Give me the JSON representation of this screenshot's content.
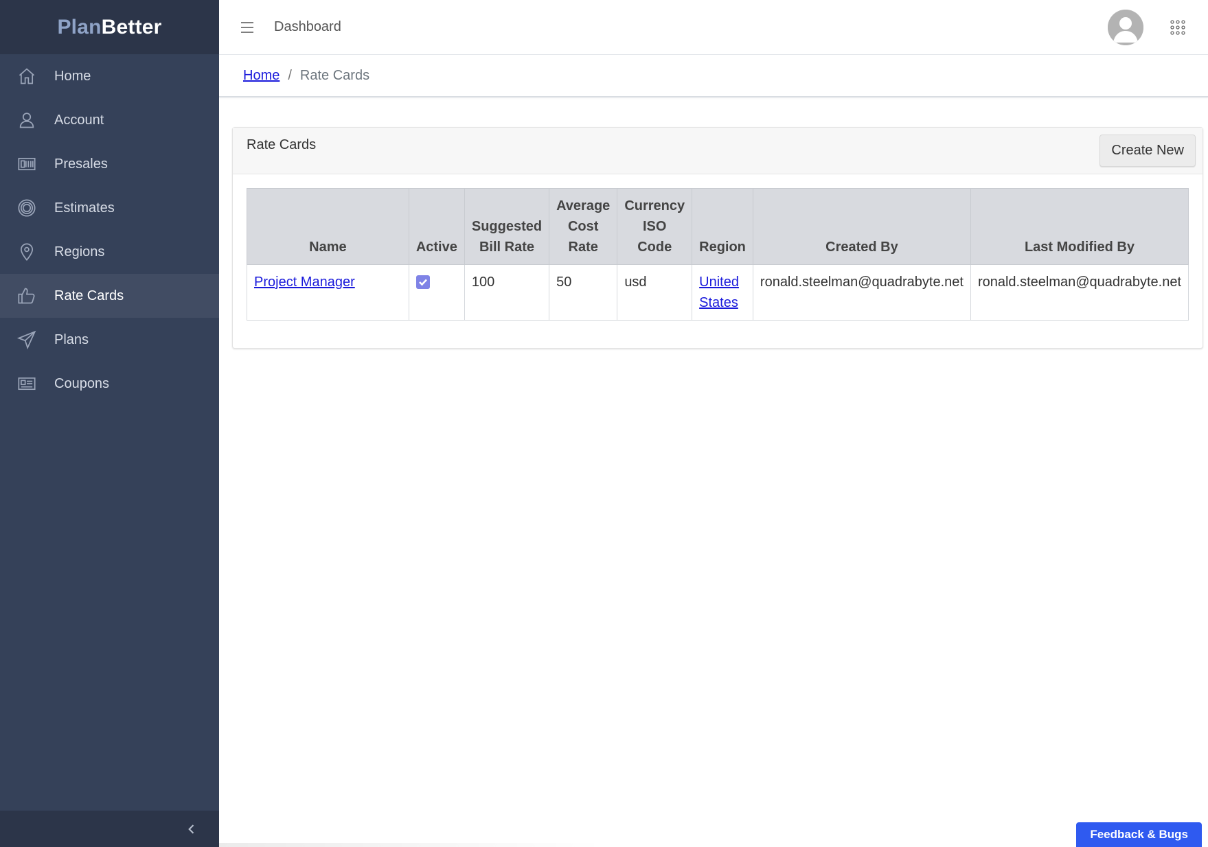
{
  "brand": {
    "part1": "Plan",
    "part2": "Better"
  },
  "sidebar": {
    "items": [
      {
        "label": "Home",
        "icon": "home-icon"
      },
      {
        "label": "Account",
        "icon": "user-icon"
      },
      {
        "label": "Presales",
        "icon": "presales-icon"
      },
      {
        "label": "Estimates",
        "icon": "target-icon"
      },
      {
        "label": "Regions",
        "icon": "map-pin-icon"
      },
      {
        "label": "Rate Cards",
        "icon": "thumbs-up-icon",
        "active": true
      },
      {
        "label": "Plans",
        "icon": "send-icon"
      },
      {
        "label": "Coupons",
        "icon": "coupon-icon"
      }
    ],
    "collapse_icon": "chevron-left-icon"
  },
  "topbar": {
    "title": "Dashboard"
  },
  "breadcrumb": {
    "home": "Home",
    "separator": "/",
    "current": "Rate Cards"
  },
  "card": {
    "title": "Rate Cards",
    "create_label": "Create New"
  },
  "table": {
    "headers": [
      "Name",
      "Active",
      "Suggested Bill Rate",
      "Average Cost Rate",
      "Currency ISO Code",
      "Region",
      "Created By",
      "Last Modified By"
    ],
    "rows": [
      {
        "name": "Project Manager",
        "active": true,
        "bill_rate": "100",
        "cost_rate": "50",
        "currency": "usd",
        "region": "United States",
        "created_by": "ronald.steelman@quadrabyte.net",
        "modified_by": "ronald.steelman@quadrabyte.net"
      }
    ]
  },
  "feedback": {
    "label": "Feedback & Bugs"
  },
  "colors": {
    "sidebar": "#354159",
    "sidebar_dark": "#2c3549",
    "accent": "#2f5af0",
    "checkbox": "#7f83e6",
    "link": "#1a1adb"
  }
}
